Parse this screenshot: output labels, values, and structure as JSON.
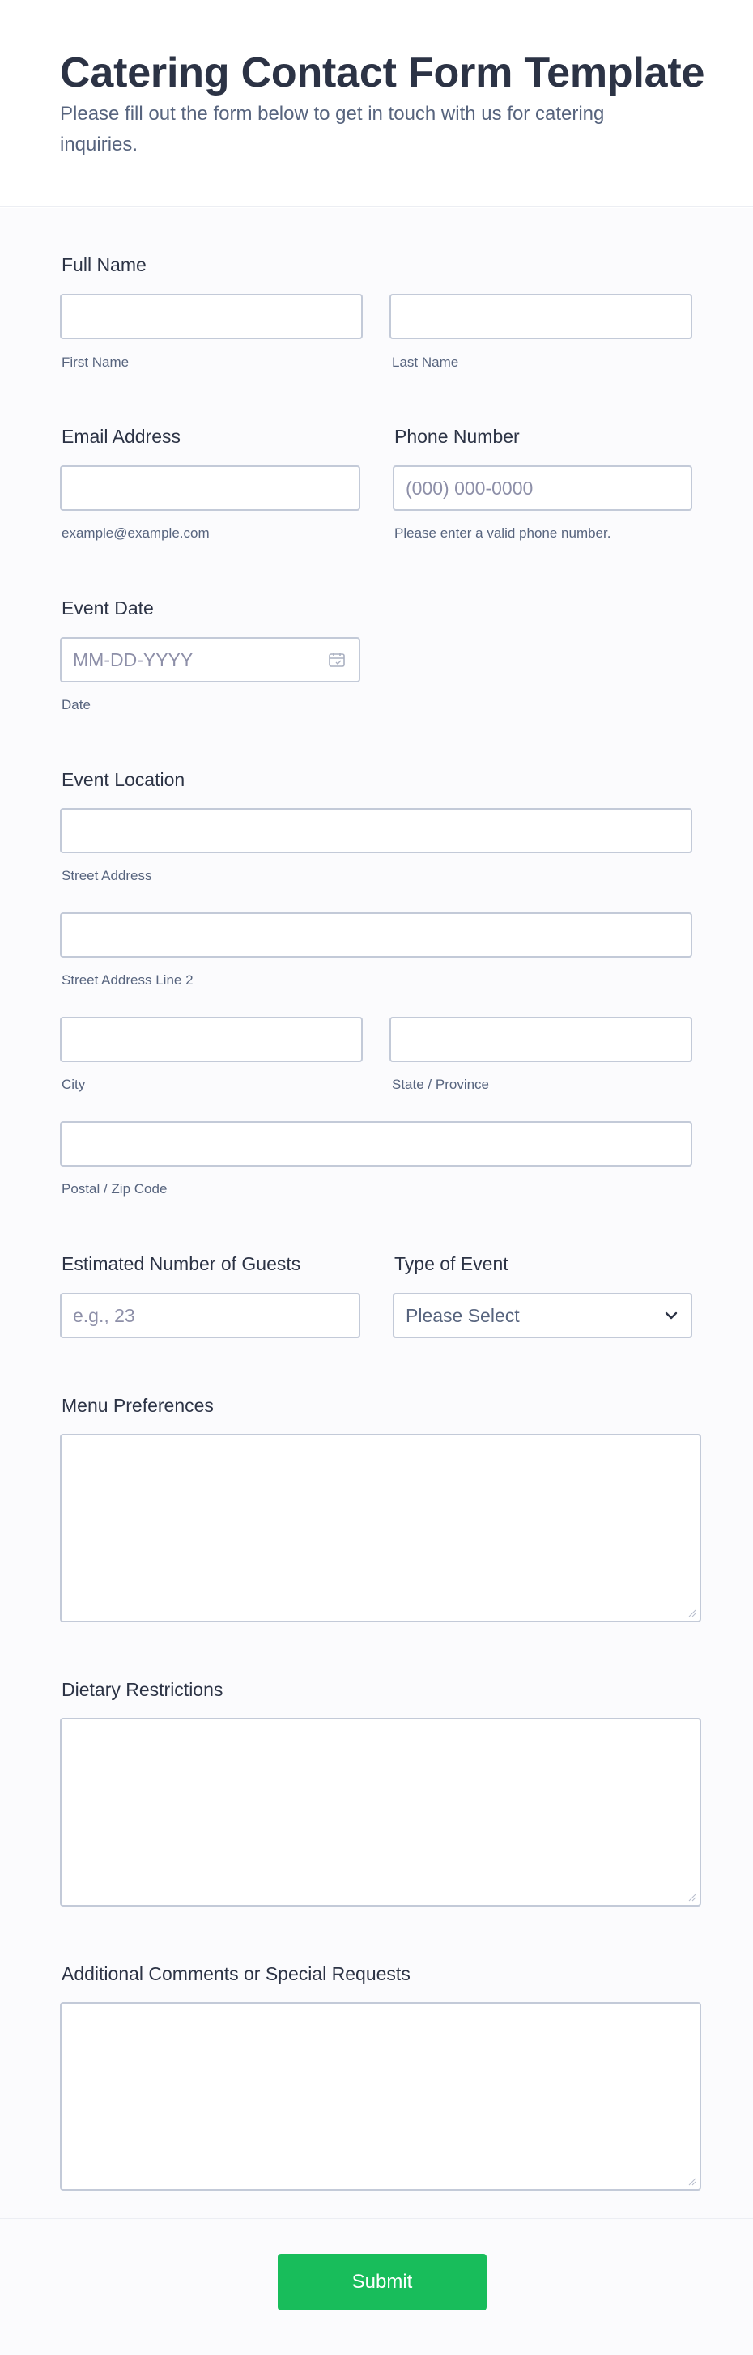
{
  "header": {
    "title": "Catering Contact Form Template",
    "subtitle": "Please fill out the form below to get in touch with us for catering inquiries."
  },
  "full_name": {
    "label": "Full Name",
    "first_sublabel": "First Name",
    "last_sublabel": "Last Name",
    "first_value": "",
    "last_value": ""
  },
  "email": {
    "label": "Email Address",
    "sublabel": "example@example.com",
    "value": ""
  },
  "phone": {
    "label": "Phone Number",
    "placeholder": "(000) 000-0000",
    "sublabel": "Please enter a valid phone number."
  },
  "event_date": {
    "label": "Event Date",
    "placeholder": "MM-DD-YYYY",
    "sublabel": "Date",
    "icon": "calendar-icon"
  },
  "location": {
    "label": "Event Location",
    "street_sublabel": "Street Address",
    "street2_sublabel": "Street Address Line 2",
    "city_sublabel": "City",
    "state_sublabel": "State / Province",
    "zip_sublabel": "Postal / Zip Code"
  },
  "guests": {
    "label": "Estimated Number of Guests",
    "placeholder": "e.g., 23"
  },
  "event_type": {
    "label": "Type of Event",
    "selected": "Please Select",
    "icon": "chevron-down-icon"
  },
  "menu_preferences": {
    "label": "Menu Preferences"
  },
  "dietary_restrictions": {
    "label": "Dietary Restrictions"
  },
  "additional_comments": {
    "label": "Additional Comments or Special Requests"
  },
  "footer": {
    "submit_label": "Submit"
  },
  "colors": {
    "accent": "#18bd5b",
    "text": "#2c3345",
    "muted": "#57647e",
    "border": "#c3cad8"
  }
}
